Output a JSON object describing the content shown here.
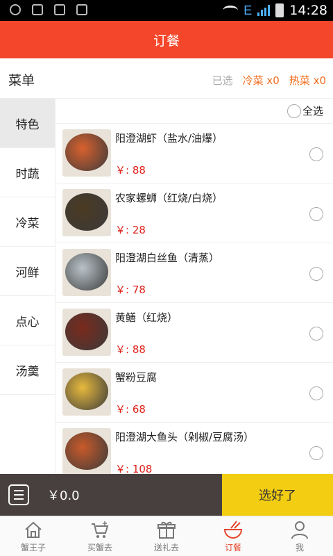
{
  "status_bar": {
    "network": "E",
    "time": "14:28"
  },
  "header": {
    "title": "订餐"
  },
  "summary": {
    "menu_label": "菜单",
    "selected_label": "已选",
    "cold_label": "冷菜 x0",
    "hot_label": "热菜 x0"
  },
  "categories": [
    {
      "label": "特色",
      "active": true
    },
    {
      "label": "时蔬",
      "active": false
    },
    {
      "label": "冷菜",
      "active": false
    },
    {
      "label": "河鲜",
      "active": false
    },
    {
      "label": "点心",
      "active": false
    },
    {
      "label": "汤羹",
      "active": false
    }
  ],
  "select_all_label": "全选",
  "dishes": [
    {
      "name": "阳澄湖虾（盐水/油爆）",
      "price": "￥: 88",
      "color": "#d9612e"
    },
    {
      "name": "农家螺蛳（红烧/白烧）",
      "price": "￥: 28",
      "color": "#4b3a22"
    },
    {
      "name": "阳澄湖白丝鱼（清蒸）",
      "price": "￥: 78",
      "color": "#b9c3c8"
    },
    {
      "name": "黄鳝（红烧）",
      "price": "￥: 88",
      "color": "#7a2a1c"
    },
    {
      "name": "蟹粉豆腐",
      "price": "￥: 68",
      "color": "#e7b93d"
    },
    {
      "name": "阳澄湖大鱼头（剁椒/豆腐汤）",
      "price": "￥: 108",
      "color": "#c95a2a"
    }
  ],
  "cart": {
    "total": "￥0.0",
    "checkout_label": "选好了"
  },
  "tabs": [
    {
      "label": "蟹王子",
      "icon": "home-icon",
      "active": false
    },
    {
      "label": "买蟹去",
      "icon": "cart-icon",
      "active": false
    },
    {
      "label": "送礼去",
      "icon": "gift-icon",
      "active": false
    },
    {
      "label": "订餐",
      "icon": "bowl-icon",
      "active": true
    },
    {
      "label": "我",
      "icon": "user-icon",
      "active": false
    }
  ],
  "colors": {
    "accent": "#f4462a",
    "price": "#e0231b",
    "checkout": "#f2cd12",
    "cart_bar": "#47403f"
  }
}
